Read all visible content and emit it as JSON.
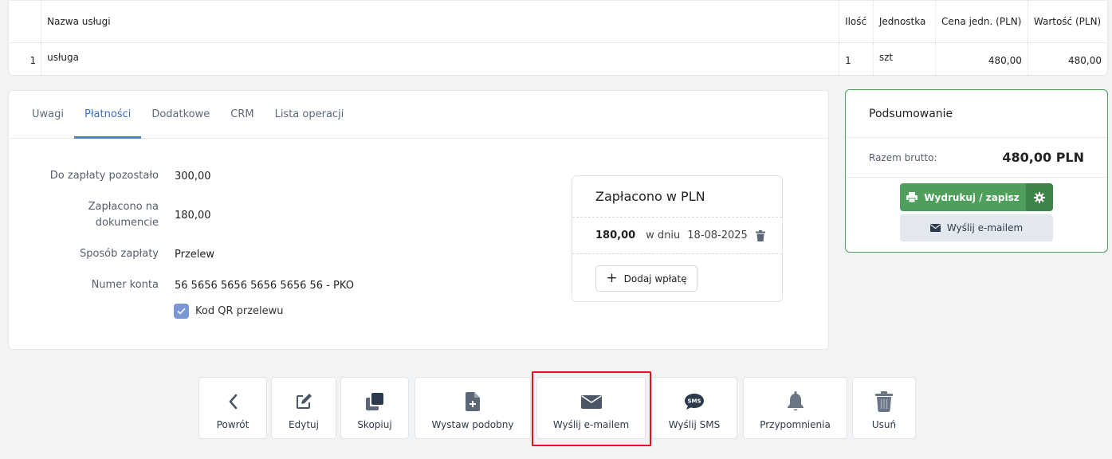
{
  "items_table": {
    "headers": [
      "",
      "Nazwa usługi",
      "Ilość",
      "Jednostka",
      "Cena jedn. (PLN)",
      "Wartość (PLN)"
    ],
    "rows": [
      {
        "lp": "1",
        "name": "usługa",
        "qty": "1",
        "unit": "szt",
        "unit_price": "480,00",
        "value": "480,00"
      }
    ]
  },
  "tabs": [
    "Uwagi",
    "Płatności",
    "Dodatkowe",
    "CRM",
    "Lista operacji"
  ],
  "active_tab": "Płatności",
  "payment": {
    "remaining_label": "Do zapłaty pozostało",
    "remaining_value": "300,00",
    "paid_label": "Zapłacono na dokumencie",
    "paid_value": "180,00",
    "method_label": "Sposób zapłaty",
    "method_value": "Przelew",
    "account_label": "Numer konta",
    "account_value": "56 5656 5656 5656 5656 56 - PKO",
    "qr_label": "Kod QR przelewu",
    "qr_checked": true
  },
  "paid_box": {
    "title": "Zapłacono w PLN",
    "amount": "180,00",
    "on_label": "w dniu",
    "date": "18-08-2025",
    "add_label": "Dodaj wpłatę"
  },
  "summary": {
    "title": "Podsumowanie",
    "total_label": "Razem brutto:",
    "total_value": "480,00 PLN",
    "print_label": "Wydrukuj / zapisz",
    "email_label": "Wyślij e-mailem"
  },
  "actions": [
    {
      "label": "Powrót",
      "icon": "chevron-left-icon"
    },
    {
      "label": "Edytuj",
      "icon": "edit-icon"
    },
    {
      "label": "Skopiuj",
      "icon": "copy-icon"
    },
    {
      "label": "Wystaw podobny",
      "icon": "file-plus-icon"
    },
    {
      "label": "Wyślij e-mailem",
      "icon": "envelope-icon"
    },
    {
      "label": "Wyślij SMS",
      "icon": "sms-icon"
    },
    {
      "label": "Przypomnienia",
      "icon": "bell-icon"
    },
    {
      "label": "Usuń",
      "icon": "trash-icon"
    }
  ],
  "colors": {
    "accent_blue": "#4a7ed4",
    "success_green": "#4e9f5b",
    "highlight_red": "#e0141c"
  }
}
